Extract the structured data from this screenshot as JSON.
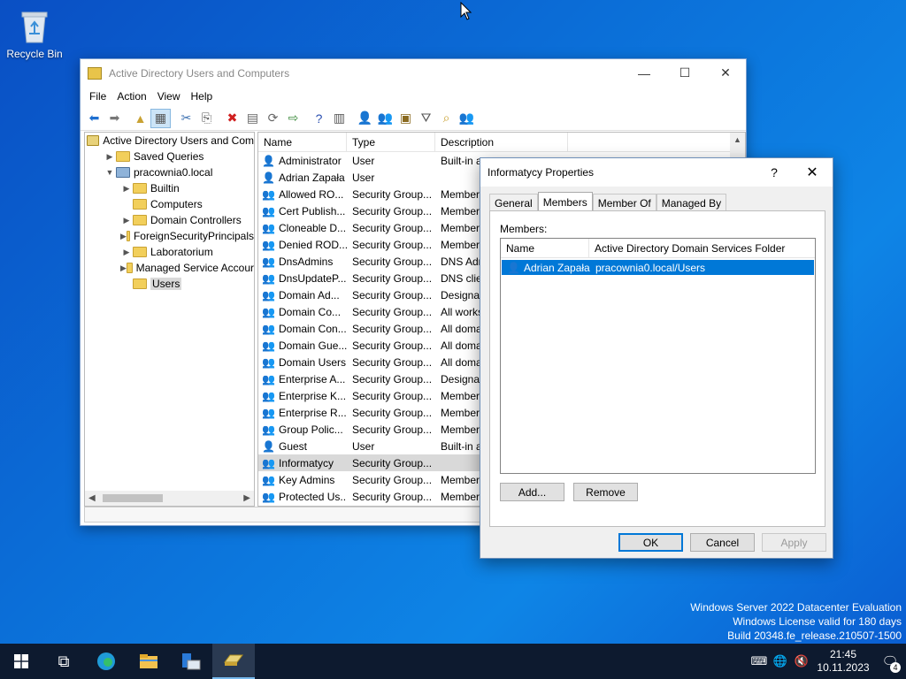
{
  "desktop": {
    "recycle_bin_label": "Recycle Bin"
  },
  "watermark": {
    "line1": "Windows Server 2022 Datacenter Evaluation",
    "line2": "Windows License valid for 180 days",
    "line3": "Build 20348.fe_release.210507-1500"
  },
  "main_window": {
    "title": "Active Directory Users and Computers",
    "menu": [
      "File",
      "Action",
      "View",
      "Help"
    ],
    "tree": [
      {
        "label": "Active Directory Users and Com",
        "arrow": "",
        "icon": "aduc-icon",
        "indent": 0
      },
      {
        "label": "Saved Queries",
        "arrow": "›",
        "icon": "folder-icon",
        "indent": 1
      },
      {
        "label": "pracownia0.local",
        "arrow": "⌄",
        "icon": "domain-icon",
        "indent": 1
      },
      {
        "label": "Builtin",
        "arrow": "›",
        "icon": "folder-icon",
        "indent": 2
      },
      {
        "label": "Computers",
        "arrow": "",
        "icon": "folder-icon",
        "indent": 2
      },
      {
        "label": "Domain Controllers",
        "arrow": "›",
        "icon": "folder-icon",
        "indent": 2
      },
      {
        "label": "ForeignSecurityPrincipals",
        "arrow": "›",
        "icon": "folder-icon",
        "indent": 2
      },
      {
        "label": "Laboratorium",
        "arrow": "›",
        "icon": "folder-icon",
        "indent": 2
      },
      {
        "label": "Managed Service Accour",
        "arrow": "›",
        "icon": "folder-icon",
        "indent": 2
      },
      {
        "label": "Users",
        "arrow": "",
        "icon": "folder-icon",
        "indent": 2,
        "selected": true
      }
    ],
    "columns": [
      "Name",
      "Type",
      "Description"
    ],
    "rows": [
      {
        "name": "Administrator",
        "type": "User",
        "desc": "Built-in a",
        "kind": "user"
      },
      {
        "name": "Adrian Zapała",
        "type": "User",
        "desc": "",
        "kind": "user"
      },
      {
        "name": "Allowed RO...",
        "type": "Security Group...",
        "desc": "Member",
        "kind": "group"
      },
      {
        "name": "Cert Publish...",
        "type": "Security Group...",
        "desc": "Member",
        "kind": "group"
      },
      {
        "name": "Cloneable D...",
        "type": "Security Group...",
        "desc": "Member",
        "kind": "group"
      },
      {
        "name": "Denied ROD...",
        "type": "Security Group...",
        "desc": "Member",
        "kind": "group"
      },
      {
        "name": "DnsAdmins",
        "type": "Security Group...",
        "desc": "DNS Adr",
        "kind": "group"
      },
      {
        "name": "DnsUpdateP...",
        "type": "Security Group...",
        "desc": "DNS clie",
        "kind": "group"
      },
      {
        "name": "Domain Ad...",
        "type": "Security Group...",
        "desc": "Designat",
        "kind": "group"
      },
      {
        "name": "Domain Co...",
        "type": "Security Group...",
        "desc": "All works",
        "kind": "group"
      },
      {
        "name": "Domain Con...",
        "type": "Security Group...",
        "desc": "All doma",
        "kind": "group"
      },
      {
        "name": "Domain Gue...",
        "type": "Security Group...",
        "desc": "All doma",
        "kind": "group"
      },
      {
        "name": "Domain Users",
        "type": "Security Group...",
        "desc": "All doma",
        "kind": "group"
      },
      {
        "name": "Enterprise A...",
        "type": "Security Group...",
        "desc": "Designat",
        "kind": "group"
      },
      {
        "name": "Enterprise K...",
        "type": "Security Group...",
        "desc": "Member",
        "kind": "group"
      },
      {
        "name": "Enterprise R...",
        "type": "Security Group...",
        "desc": "Member",
        "kind": "group"
      },
      {
        "name": "Group Polic...",
        "type": "Security Group...",
        "desc": "Member",
        "kind": "group"
      },
      {
        "name": "Guest",
        "type": "User",
        "desc": "Built-in a",
        "kind": "user"
      },
      {
        "name": "Informatycy",
        "type": "Security Group...",
        "desc": "",
        "kind": "group",
        "selected": true
      },
      {
        "name": "Key Admins",
        "type": "Security Group...",
        "desc": "Member",
        "kind": "group"
      },
      {
        "name": "Protected Us...",
        "type": "Security Group...",
        "desc": "Member",
        "kind": "group"
      }
    ]
  },
  "dialog": {
    "title": "Informatycy Properties",
    "help": "?",
    "tabs": [
      "General",
      "Members",
      "Member Of",
      "Managed By"
    ],
    "active_tab": "Members",
    "members_label": "Members:",
    "member_columns": [
      "Name",
      "Active Directory Domain Services Folder"
    ],
    "members": [
      {
        "name": "Adrian Zapała",
        "folder": "pracownia0.local/Users"
      }
    ],
    "add_label": "Add...",
    "remove_label": "Remove",
    "ok_label": "OK",
    "cancel_label": "Cancel",
    "apply_label": "Apply"
  },
  "taskbar": {
    "time": "21:45",
    "date": "10.11.2023",
    "notification_count": "4"
  }
}
